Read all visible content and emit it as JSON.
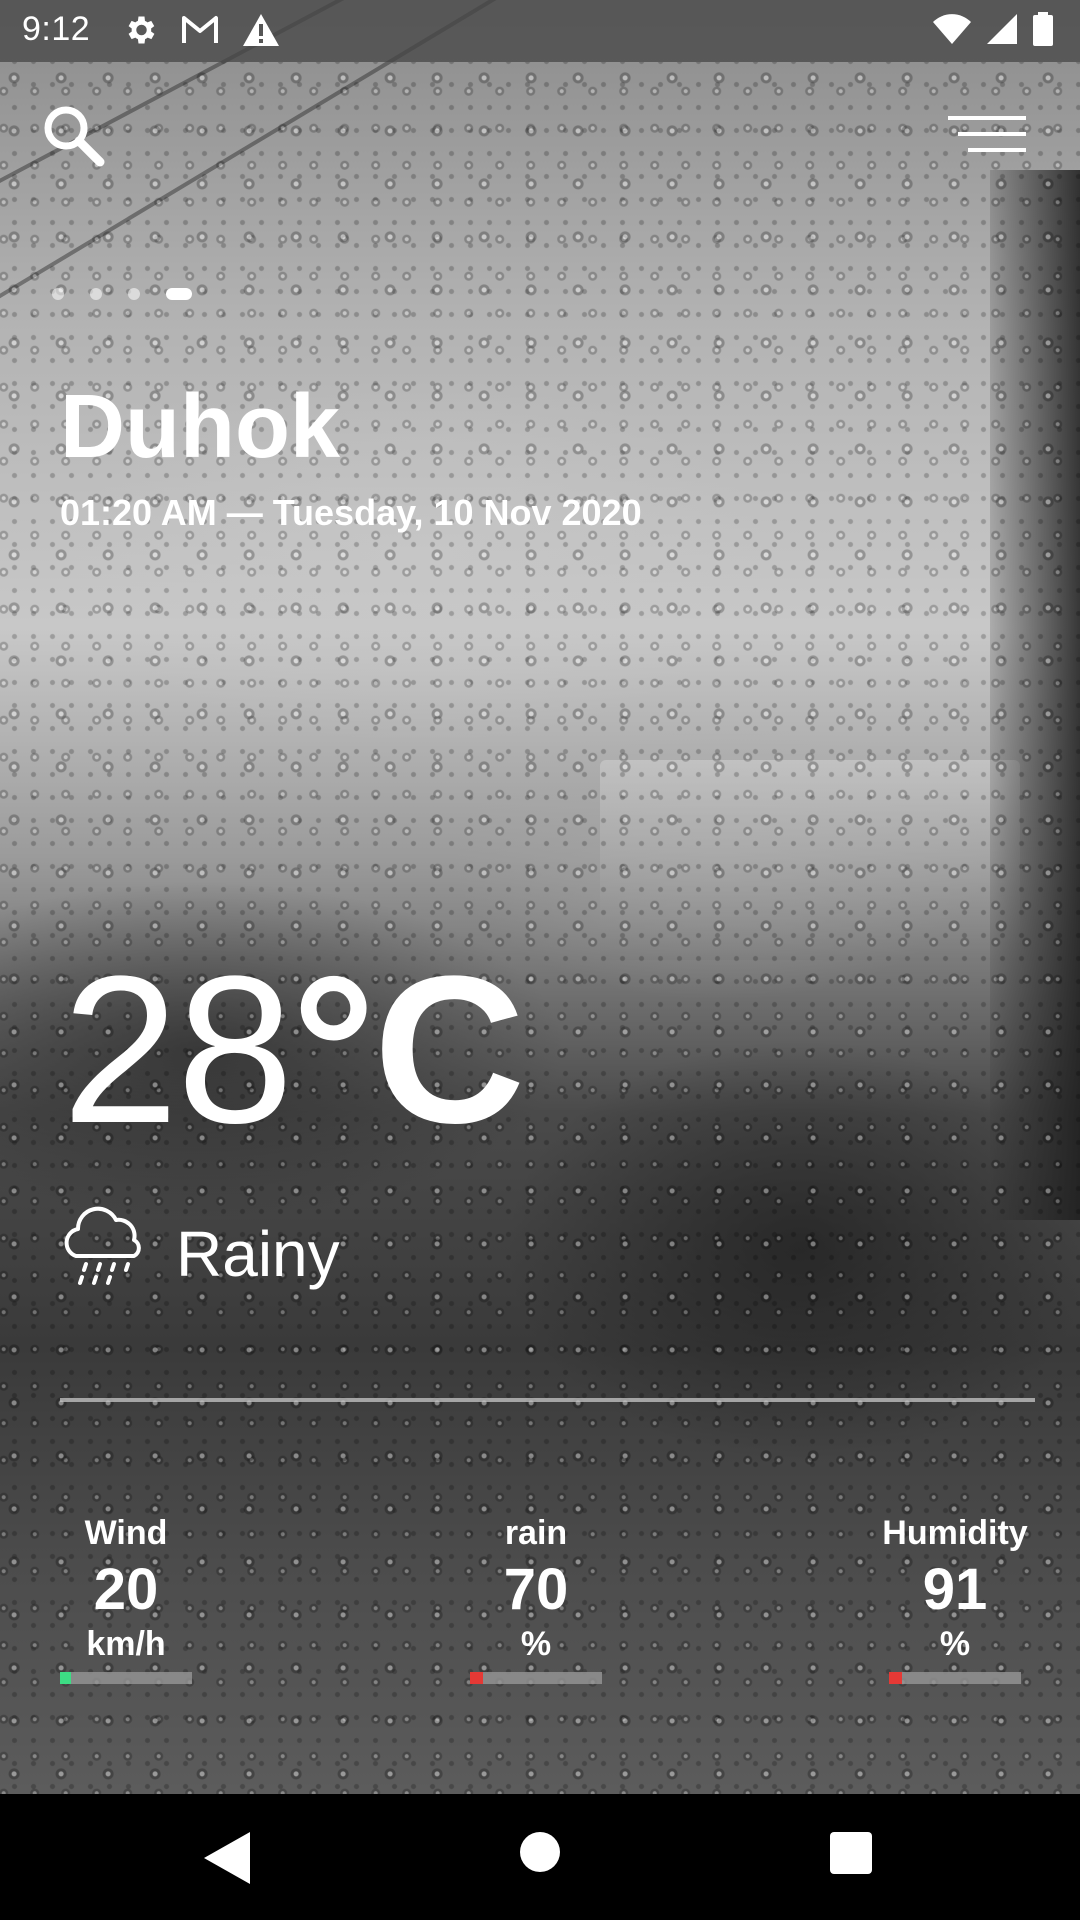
{
  "status_bar": {
    "time": "9:12",
    "left_icons": [
      "gear-icon",
      "gmail-icon",
      "warning-icon"
    ],
    "right_icons": [
      "wifi-icon",
      "signal-icon",
      "battery-icon"
    ]
  },
  "header": {
    "search_icon": "search-icon",
    "menu_icon": "menu-icon",
    "page_count": 4,
    "active_page_index": 3
  },
  "location": {
    "city": "Duhok",
    "datetime": "01:20 AM — Tuesday, 10 Nov 2020"
  },
  "weather": {
    "temperature": "28",
    "unit": "°C",
    "condition": "Rainy",
    "condition_icon": "rain-cloud-icon"
  },
  "stats": {
    "wind": {
      "label": "Wind",
      "value": "20",
      "unit": "km/h",
      "level": 0.08,
      "color": "#3ddc84"
    },
    "rain": {
      "label": "rain",
      "value": "70",
      "unit": "%",
      "level": 0.1,
      "color": "#e53935"
    },
    "humidity": {
      "label": "Humidity",
      "value": "91",
      "unit": "%",
      "level": 0.1,
      "color": "#e53935"
    }
  },
  "nav": {
    "back_icon": "back-icon",
    "home_icon": "home-icon",
    "recents_icon": "recents-icon"
  }
}
